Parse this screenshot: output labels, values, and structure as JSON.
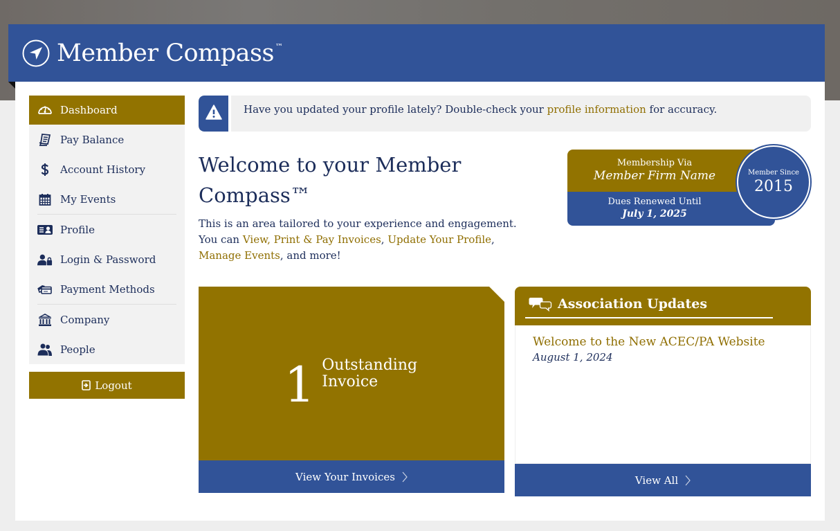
{
  "app": {
    "title": "Member Compass",
    "trademark": "™",
    "logo_icon": "compass-navigation-icon"
  },
  "colors": {
    "primary_blue": "#315398",
    "accent_gold": "#927300",
    "text_navy": "#1c2d5a",
    "link_gold": "#8f6e00"
  },
  "sidebar": {
    "items": [
      {
        "label": "Dashboard",
        "icon": "dashboard-gauge-icon",
        "active": true
      },
      {
        "label": "Pay Balance",
        "icon": "receipt-icon"
      },
      {
        "label": "Account History",
        "icon": "dollar-icon"
      },
      {
        "label": "My Events",
        "icon": "calendar-icon"
      },
      {
        "label": "Profile",
        "icon": "id-card-icon"
      },
      {
        "label": "Login & Password",
        "icon": "user-lock-icon"
      },
      {
        "label": "Payment Methods",
        "icon": "credit-cards-icon"
      },
      {
        "label": "Company",
        "icon": "bank-building-icon"
      },
      {
        "label": "People",
        "icon": "users-icon"
      }
    ],
    "logout_label": "Logout"
  },
  "alert": {
    "icon": "warning-icon",
    "text_before": "Have you updated your profile lately? Double-check your ",
    "link_text": "profile information",
    "text_after": " for accuracy."
  },
  "welcome": {
    "heading": "Welcome to your Member Compass™",
    "intro_before": "This is an area tailored to your experience and engagement. You can ",
    "links": [
      "View, Print & Pay Invoices",
      "Update Your Profile",
      "Manage Events"
    ],
    "separator": ", ",
    "intro_after": ", and more!"
  },
  "membership": {
    "via_label": "Membership Via",
    "firm_name": "Member Firm Name",
    "dues_label": "Dues Renewed Until",
    "dues_date": "July 1, 2025",
    "since_label": "Member Since",
    "since_year": "2015"
  },
  "invoices": {
    "count": "1",
    "label": "Outstanding Invoice",
    "button_label": "View Your Invoices"
  },
  "updates": {
    "title": "Association Updates",
    "icon": "chat-bubbles-icon",
    "items": [
      {
        "title": "Welcome to the New ACEC/PA Website",
        "date": "August 1, 2024"
      }
    ],
    "button_label": "View All"
  }
}
